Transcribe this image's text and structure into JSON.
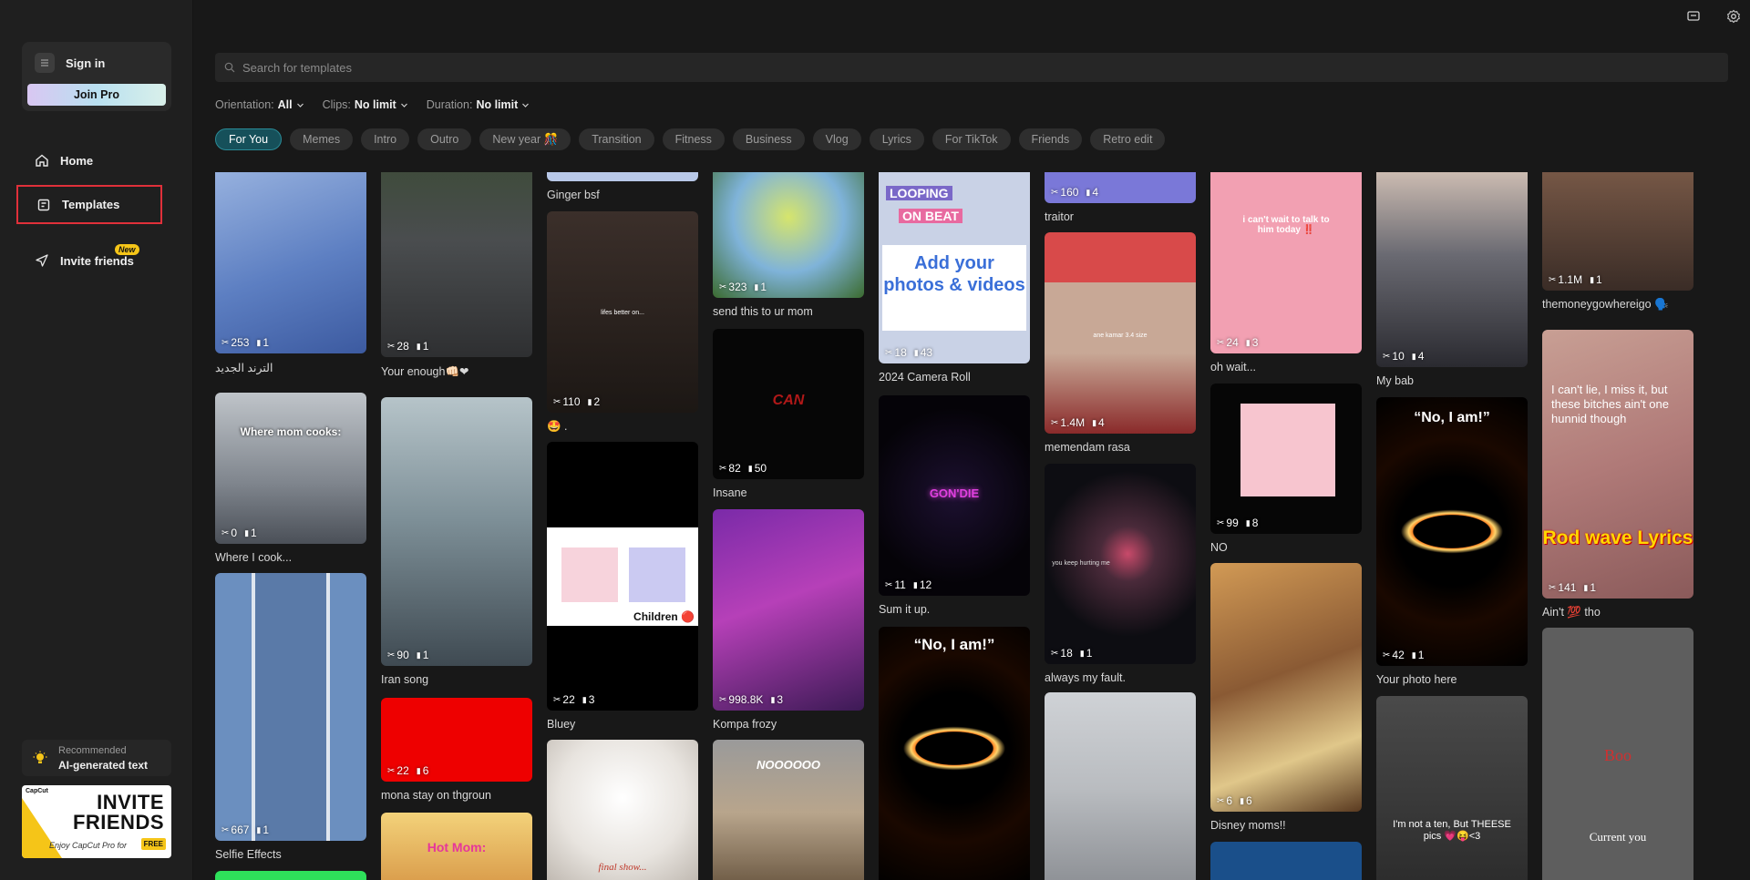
{
  "sidebar": {
    "sign_in": "Sign in",
    "join_pro": "Join Pro",
    "nav": [
      {
        "label": "Home"
      },
      {
        "label": "Templates"
      },
      {
        "label": "Invite friends",
        "badge": "New"
      }
    ],
    "recommended": {
      "label": "Recommended",
      "title": "AI-generated text"
    },
    "invite_banner": {
      "logo": "CapCut",
      "title": "INVITE FRIENDS",
      "subtitle": "Enjoy CapCut Pro for",
      "free": "FREE"
    }
  },
  "search": {
    "placeholder": "Search for templates"
  },
  "filters": [
    {
      "label": "Orientation:",
      "value": "All"
    },
    {
      "label": "Clips:",
      "value": "No limit"
    },
    {
      "label": "Duration:",
      "value": "No limit"
    }
  ],
  "chips": [
    "For You",
    "Memes",
    "Intro",
    "Outro",
    "New year 🎊",
    "Transition",
    "Fitness",
    "Business",
    "Vlog",
    "Lyrics",
    "For TikTok",
    "Friends",
    "Retro edit"
  ],
  "active_chip": "For You",
  "cards": {
    "c1a": {
      "title": "الترند الجديد",
      "uses": "253",
      "clips": "1"
    },
    "c1b": {
      "title": "Where I cook...",
      "uses": "0",
      "clips": "1",
      "overlay": "Where mom cooks:"
    },
    "c1c": {
      "title": "Selfie Effects",
      "uses": "667",
      "clips": "1"
    },
    "c2a": {
      "title": "Your enough👊🏻❤",
      "uses": "28",
      "clips": "1"
    },
    "c2b": {
      "title": "Iran song",
      "uses": "90",
      "clips": "1"
    },
    "c2c": {
      "title": "mona stay on thgroun",
      "uses": "22",
      "clips": "6"
    },
    "c2d": {
      "overlay": "Hot Mom:"
    },
    "c3a": {
      "title": "Ginger bsf"
    },
    "c3b": {
      "title": "🤩 .",
      "uses": "110",
      "clips": "2",
      "overlay": "lifes better on..."
    },
    "c3c": {
      "title": "Bluey",
      "uses": "22",
      "clips": "3",
      "overlay": "Children 🔴"
    },
    "c3d": {
      "overlay": "final show..."
    },
    "c4a": {
      "title": "send this to ur mom",
      "uses": "323",
      "clips": "1"
    },
    "c4b": {
      "title": "Insane",
      "uses": "82",
      "clips": "50",
      "overlay": "CAN"
    },
    "c4c": {
      "title": "Kompa frozy",
      "uses": "998.8K",
      "clips": "3"
    },
    "c4d": {
      "overlay": "NOOOOOO"
    },
    "c5a": {
      "title": "2024 Camera Roll",
      "uses": "18",
      "clips": "43",
      "overlay1": "LOOPING",
      "overlay2": "ON BEAT",
      "overlay3": "Add your photos & videos"
    },
    "c5b": {
      "title": "Sum it up.",
      "uses": "11",
      "clips": "12",
      "overlay": "GON'DIE"
    },
    "c5c": {
      "overlay": "“No, I am!”"
    },
    "c6a": {
      "title": "traitor",
      "uses": "160",
      "clips": "4"
    },
    "c6b": {
      "title": "memendam rasa",
      "uses": "1.4M",
      "clips": "4",
      "overlay": "ane kamar 3.4 size"
    },
    "c6c": {
      "title": "always my fault.",
      "uses": "18",
      "clips": "1",
      "overlay": "you keep hurting me"
    },
    "c7a": {
      "title": "oh wait...",
      "uses": "24",
      "clips": "3",
      "overlay": "i can't wait to talk to him today ‼️"
    },
    "c7b": {
      "title": "NO",
      "uses": "99",
      "clips": "8"
    },
    "c7c": {
      "title": "Disney moms!!",
      "uses": "6",
      "clips": "6"
    },
    "c8a": {
      "title": "My bab",
      "uses": "10",
      "clips": "4"
    },
    "c8b": {
      "title": "Your photo here",
      "uses": "42",
      "clips": "1",
      "overlay": "“No, I am!”"
    },
    "c8c": {
      "overlay": "I'm not a ten, But THEESE pics 💗😝<3"
    },
    "c9a": {
      "title": "themoneygowhereigo 🗣️",
      "uses": "1.1M",
      "clips": "1"
    },
    "c9b": {
      "title": "Ain't 💯 tho",
      "uses": "141",
      "clips": "1",
      "overlay1": "I can't lie, I miss it, but these bitches ain't one hunnid though",
      "overlay2": "Rod wave Lyrics"
    },
    "c9c": {
      "overlay1": "Boo",
      "overlay2": "Current you"
    }
  },
  "colors": {
    "background": "#181818",
    "sidebar": "#1f1f1f",
    "accent_chip": "#16505a",
    "selection_border": "#e0303a"
  }
}
